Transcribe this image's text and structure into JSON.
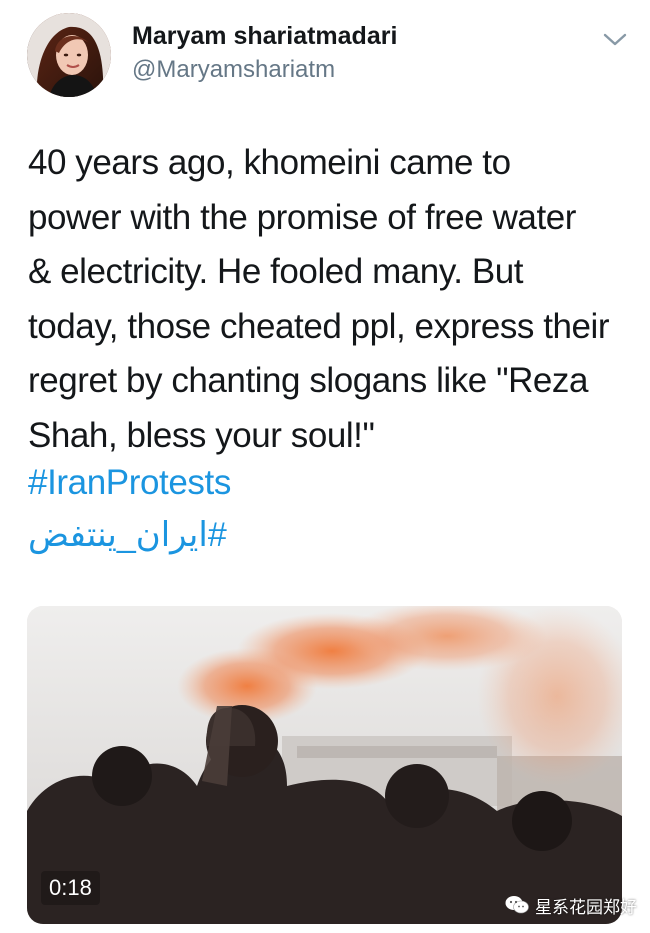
{
  "tweet": {
    "author_name": "Maryam shariatmadari",
    "author_handle": "@Maryamshariatm",
    "text": "40 years ago, khomeini came to\npower with the promise of free water\n& electricity. He fooled many. But\ntoday, those cheated ppl, express their\nregret by chanting slogans like \"Reza\nShah, bless your soul!\"",
    "hashtags": [
      "#IranProtests",
      "#ایران_ینتفض"
    ]
  },
  "media": {
    "type": "video",
    "duration": "0:18"
  },
  "watermark": {
    "icon": "wechat-icon",
    "text": "星系花园郑好"
  },
  "colors": {
    "link": "#1b95e0",
    "secondary_text": "#657786",
    "primary_text": "#14171a"
  }
}
